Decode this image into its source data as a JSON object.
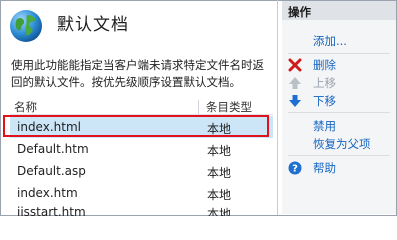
{
  "page": {
    "title": "默认文档",
    "description": "使用此功能能指定当客户端未请求特定文件名时返回的默认文件。按优先级顺序设置默认文档。"
  },
  "table": {
    "headers": [
      "名称",
      "条目类型"
    ],
    "rows": [
      {
        "name": "index.html",
        "type": "本地",
        "selected": true
      },
      {
        "name": "Default.htm",
        "type": "本地"
      },
      {
        "name": "Default.asp",
        "type": "本地"
      },
      {
        "name": "index.htm",
        "type": "本地"
      },
      {
        "name": "iisstart.htm",
        "type": "本地"
      }
    ]
  },
  "actions": {
    "title": "操作",
    "add": "添加...",
    "remove": "删除",
    "move_up": "上移",
    "move_down": "下移",
    "disable": "禁用",
    "revert": "恢复为父项",
    "help": "帮助"
  },
  "colors": {
    "link": "#1565c0",
    "disabled": "#9aa3ad",
    "selection_row": "#cde6f7",
    "highlight_box": "#e0111a"
  },
  "icons": [
    "globe-icon",
    "delete-icon",
    "move-up-icon",
    "move-down-icon",
    "help-icon"
  ]
}
